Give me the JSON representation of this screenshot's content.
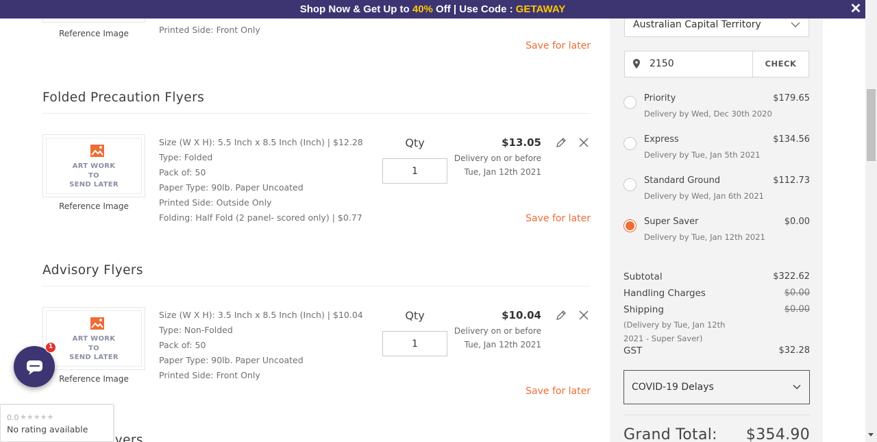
{
  "promo": {
    "text_before": "Shop Now & Get Up to ",
    "highlight_pct": "40%",
    "text_middle": " Off | Use Code : ",
    "code": "GETAWAY",
    "close_symbol": "✕"
  },
  "items": [
    {
      "title": "",
      "reference_label": "Reference Image",
      "specs": [
        "Printed Side: Front Only"
      ],
      "save_for_later": "Save for later"
    },
    {
      "title": "Folded Precaution Flyers",
      "art_text": [
        "ART WORK",
        "TO",
        "SEND LATER"
      ],
      "reference_label": "Reference Image",
      "specs": [
        "Size (W X H): 5.5 Inch x 8.5 Inch (Inch) | $12.28",
        "Type: Folded",
        "Pack of: 50",
        "Paper Type: 90lb. Paper Uncoated",
        "Printed Side: Outside Only",
        "Folding: Half Fold (2 panel- scored only) | $0.77"
      ],
      "qty_label": "Qty",
      "qty_value": "1",
      "price": "$13.05",
      "delivery_line1": "Delivery on or before",
      "delivery_line2": "Tue, Jan 12th 2021",
      "save_for_later": "Save for later"
    },
    {
      "title": "Advisory Flyers",
      "art_text": [
        "ART WORK",
        "TO",
        "SEND LATER"
      ],
      "reference_label": "Reference Image",
      "specs": [
        "Size (W X H): 3.5 Inch x 8.5 Inch (Inch) | $10.04",
        "Type: Non-Folded",
        "Pack of: 50",
        "Paper Type: 90lb. Paper Uncoated",
        "Printed Side: Front Only"
      ],
      "qty_label": "Qty",
      "qty_value": "1",
      "price": "$10.04",
      "delivery_line1": "Delivery on or before",
      "delivery_line2": "Tue, Jan 12th 2021",
      "save_for_later": "Save for later"
    },
    {
      "title": "Advisory Flyers"
    }
  ],
  "sidebar": {
    "state": "Australian Capital Territory",
    "zip": "2150",
    "check_label": "CHECK",
    "shipping_options": [
      {
        "name": "Priority",
        "date": "Delivery by Wed, Dec 30th 2020",
        "price": "$179.65",
        "selected": false
      },
      {
        "name": "Express",
        "date": "Delivery by Tue, Jan 5th 2021",
        "price": "$134.56",
        "selected": false
      },
      {
        "name": "Standard Ground",
        "date": "Delivery by Wed, Jan 6th 2021",
        "price": "$112.73",
        "selected": false
      },
      {
        "name": "Super Saver",
        "date": "Delivery by Tue, Jan 12th 2021",
        "price": "$0.00",
        "selected": true
      }
    ],
    "summary": {
      "subtotal_label": "Subtotal",
      "subtotal": "$322.62",
      "handling_label": "Handling Charges",
      "handling": "$0.00",
      "shipping_label": "Shipping",
      "shipping": "$0.00",
      "shipping_note_line1": "(Delivery by Tue, Jan 12th",
      "shipping_note_line2": "2021 - Super Saver)",
      "gst_label": "GST",
      "gst": "$32.28"
    },
    "covid_label": "COVID-19 Delays",
    "grand_total_label": "Grand Total:",
    "grand_total": "$354.90"
  },
  "chat": {
    "badge_count": "1"
  },
  "rating": {
    "score": "0.0",
    "stars": "★★★★★",
    "text": "No rating available"
  },
  "colors": {
    "brand_purple": "#3d3572",
    "accent_orange": "#f06b35",
    "promo_yellow": "#ffc800"
  }
}
